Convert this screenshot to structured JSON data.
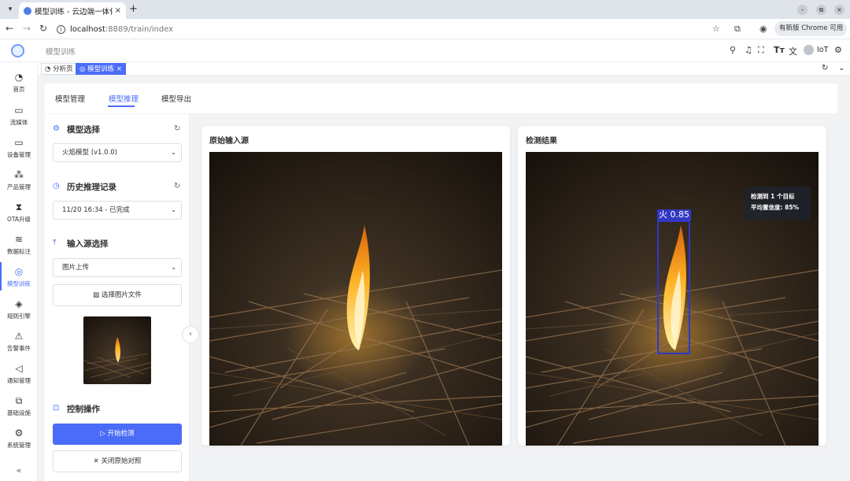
{
  "browser": {
    "tab_title": "模型训练 - 云边端一体化",
    "tab_close": "×",
    "new_tab": "+",
    "url_host": "localhost",
    "url_path": ":8889/train/index",
    "update_label": "有新版 Chrome 可用",
    "window_controls": [
      "–",
      "⧉",
      "×"
    ]
  },
  "header": {
    "breadcrumb": "模型训练",
    "user_name": "IoT"
  },
  "sidebar": {
    "items": [
      {
        "label": "首页",
        "icon": "dashboard-icon",
        "glyph": "◔"
      },
      {
        "label": "流媒体",
        "icon": "video-icon",
        "glyph": "▭"
      },
      {
        "label": "设备管理",
        "icon": "monitor-icon",
        "glyph": "▭"
      },
      {
        "label": "产品管理",
        "icon": "nodes-icon",
        "glyph": "⁂"
      },
      {
        "label": "OTA升级",
        "icon": "hourglass-icon",
        "glyph": "⧗"
      },
      {
        "label": "数据标注",
        "icon": "database-icon",
        "glyph": "≋"
      },
      {
        "label": "模型训练",
        "icon": "brain-icon",
        "glyph": "◎"
      },
      {
        "label": "规则引擎",
        "icon": "diamond-icon",
        "glyph": "◈"
      },
      {
        "label": "告警事件",
        "icon": "alarm-icon",
        "glyph": "⚠"
      },
      {
        "label": "通知管理",
        "icon": "speaker-icon",
        "glyph": "◁"
      },
      {
        "label": "基础设施",
        "icon": "layers-icon",
        "glyph": "⧉"
      },
      {
        "label": "系统管理",
        "icon": "gear-icon",
        "glyph": "⚙"
      }
    ],
    "active_index": 6,
    "collapse": "«"
  },
  "page_tabs": [
    {
      "label": "分析页",
      "active": false
    },
    {
      "label": "模型训练",
      "active": true,
      "close": "×"
    }
  ],
  "sub_tabs": [
    "模型管理",
    "模型推理",
    "模型导出"
  ],
  "left_panel": {
    "model_select_title": "模型选择",
    "model_value": "火焰模型 (v1.0.0)",
    "history_title": "历史推理记录",
    "history_value": "11/20 16:34 - 已完成",
    "input_title": "输入源选择",
    "input_value": "图片上传",
    "choose_file_label": "选择图片文件",
    "control_title": "控制操作",
    "start_label": "开始检测",
    "close_compare_label": "关闭原始对照"
  },
  "cards": {
    "original_title": "原始输入源",
    "result_title": "检测结果"
  },
  "detection": {
    "label": "火 0.85",
    "summary_line1": "检测到 1 个目标",
    "summary_line2": "平均置信度: 85%",
    "box_color": "#3038c4"
  },
  "colors": {
    "primary": "#4a6cf7"
  }
}
